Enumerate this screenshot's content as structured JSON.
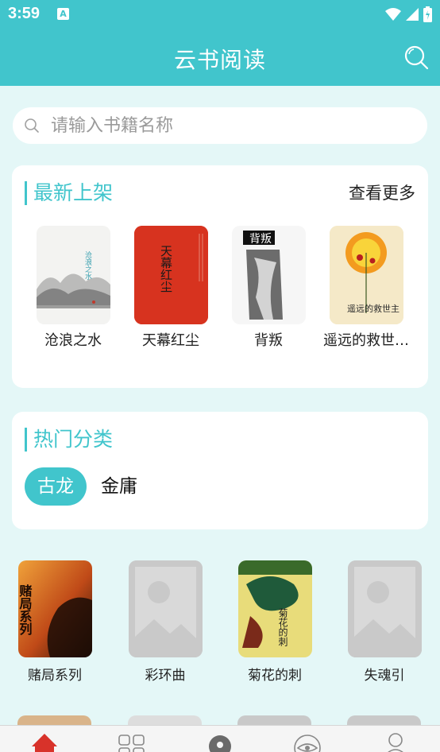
{
  "status_bar": {
    "time": "3:59",
    "notification_badge": "A"
  },
  "app_bar": {
    "title": "云书阅读"
  },
  "search": {
    "placeholder": "请输入书籍名称"
  },
  "new_arrivals": {
    "title": "最新上架",
    "more_label": "查看更多",
    "books": [
      {
        "title": "沧浪之水",
        "cover_text": "沧浪之水"
      },
      {
        "title": "天幕红尘",
        "cover_text": "天幕红尘"
      },
      {
        "title": "背叛",
        "cover_text": "背叛"
      },
      {
        "title": "遥远的救世…",
        "cover_text": "遥远的救世主"
      }
    ]
  },
  "hot_categories": {
    "title": "热门分类",
    "categories": [
      {
        "label": "古龙",
        "active": true
      },
      {
        "label": "金庸",
        "active": false
      }
    ]
  },
  "book_grid": [
    {
      "title": "赌局系列",
      "cover": "image",
      "cover_text": "赌局系列"
    },
    {
      "title": "彩环曲",
      "cover": "placeholder"
    },
    {
      "title": "菊花的刺",
      "cover": "image",
      "cover_text": "菊花的刺"
    },
    {
      "title": "失魂引",
      "cover": "placeholder"
    }
  ],
  "bottom_nav": {
    "items": [
      {
        "icon": "home-icon",
        "active": true
      },
      {
        "icon": "grid-icon",
        "active": false
      },
      {
        "icon": "location-icon",
        "active": false
      },
      {
        "icon": "eye-icon",
        "active": false
      },
      {
        "icon": "user-icon",
        "active": false
      }
    ]
  },
  "colors": {
    "accent": "#41c5cc",
    "background": "#e4f7f7",
    "active_nav": "#d8322a",
    "placeholder": "#c9c9c9"
  }
}
